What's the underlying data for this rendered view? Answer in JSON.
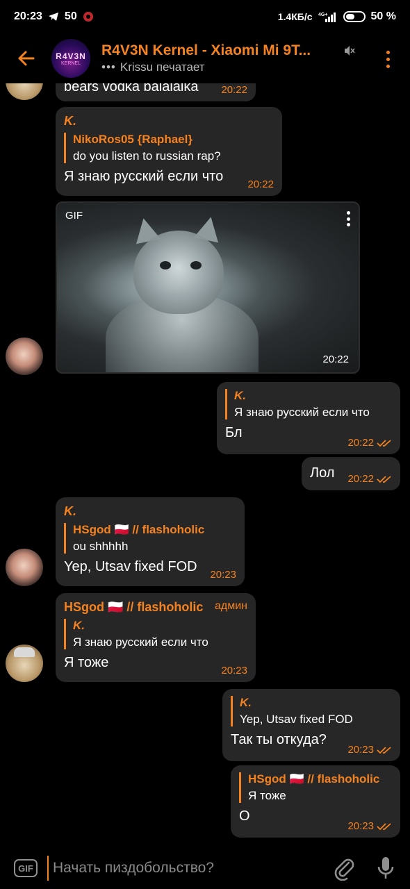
{
  "status_bar": {
    "time": "20:23",
    "notif_count": "50",
    "net_speed": "1.4КБ/с",
    "network": "4G+",
    "battery": "50 %"
  },
  "header": {
    "title": "R4V3N Kernel - Xiaomi Mi 9T...",
    "typing_dots": "•••",
    "subtitle": "Krissu печатает",
    "avatar_text": "R4V3N",
    "avatar_sub": "KERNEL"
  },
  "messages": {
    "m0": {
      "text": "bears vodka balalaika",
      "time": "20:22"
    },
    "m1": {
      "sender": "K.",
      "reply_name": "NikoRos05 {Raphael}",
      "reply_text": "do you listen to russian rap?",
      "text": "Я знаю русский если что",
      "time": "20:22"
    },
    "gif": {
      "label": "GIF",
      "time": "20:22"
    },
    "m2": {
      "reply_name": "K.",
      "reply_text": "Я знаю русский если что",
      "text": "Бл",
      "time": "20:22"
    },
    "m3": {
      "text": "Лол",
      "time": "20:22"
    },
    "m4": {
      "sender": "K.",
      "reply_name": "HSgod 🇵🇱 // flashoholic",
      "reply_text": "ou shhhhh",
      "text": "Yep, Utsav fixed FOD",
      "time": "20:23"
    },
    "m5": {
      "sender": "HSgod 🇵🇱 // flashoholic",
      "admin": "админ",
      "reply_name": "K.",
      "reply_text": "Я знаю русский если что",
      "text": "Я тоже",
      "time": "20:23"
    },
    "m6": {
      "reply_name": "K.",
      "reply_text": "Yep, Utsav fixed FOD",
      "text": "Так ты откуда?",
      "time": "20:23"
    },
    "m7": {
      "reply_name": "HSgod 🇵🇱 // flashoholic",
      "reply_text": "Я тоже",
      "text": "О",
      "time": "20:23"
    }
  },
  "input_bar": {
    "gif_label": "GIF",
    "placeholder": "Начать пиздобольство?"
  },
  "colors": {
    "accent": "#f58220",
    "bubble": "#262626",
    "background": "#000000"
  },
  "icons": [
    "back-arrow-icon",
    "mute-icon",
    "more-vert-icon",
    "attach-icon",
    "mic-icon",
    "double-check-icon"
  ]
}
